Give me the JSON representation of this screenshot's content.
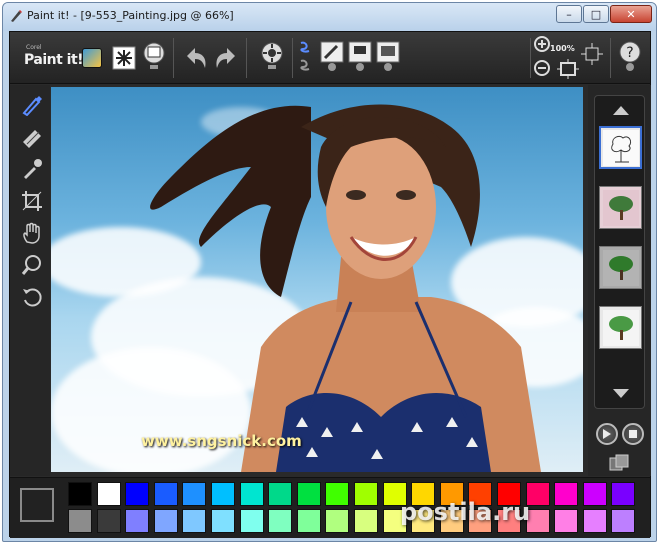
{
  "window": {
    "title": "Paint it! - [9-553_Painting.jpg @ 66%]",
    "min_label": "–",
    "max_label": "□",
    "close_label": "✕"
  },
  "toolbar": {
    "logo_small": "Corel",
    "logo_text": "Paint it!",
    "zoom_value": "100%",
    "help_label": "?"
  },
  "tools": [
    {
      "name": "brush-icon"
    },
    {
      "name": "eraser-icon"
    },
    {
      "name": "eyedropper-icon"
    },
    {
      "name": "crop-icon"
    },
    {
      "name": "hand-icon"
    },
    {
      "name": "zoom-icon"
    },
    {
      "name": "rotate-icon"
    }
  ],
  "canvas": {
    "watermark": "www.sngsnick.com"
  },
  "thumbnails": [
    {
      "style": "sketch",
      "active": true
    },
    {
      "style": "painted-pink"
    },
    {
      "style": "painted-gray"
    },
    {
      "style": "painted-white"
    }
  ],
  "palette": {
    "current": "#222222",
    "row1": [
      "#000000",
      "#ffffff",
      "#0000ff",
      "#1a5cff",
      "#1e90ff",
      "#00bfff",
      "#00e5d0",
      "#00d98a",
      "#00e040",
      "#40ff00",
      "#a0ff00",
      "#e0ff00",
      "#ffd700",
      "#ff9900",
      "#ff4000",
      "#ff0000",
      "#ff0066",
      "#ff00cc",
      "#cc00ff",
      "#7a00ff"
    ],
    "row2": [
      "#8c8c8c",
      "#3a3a3a",
      "#7f7fff",
      "#7fa6ff",
      "#7fc8ff",
      "#7fe0ff",
      "#7fffee",
      "#7fffc0",
      "#7fff9a",
      "#b0ff7f",
      "#d8ff7f",
      "#f4ff7f",
      "#ffe97f",
      "#ffcc7f",
      "#ffa07f",
      "#ff7f7f",
      "#ff7fb0",
      "#ff7fe6",
      "#e67fff",
      "#bd7fff"
    ]
  },
  "overlay_watermark": "postila.ru"
}
